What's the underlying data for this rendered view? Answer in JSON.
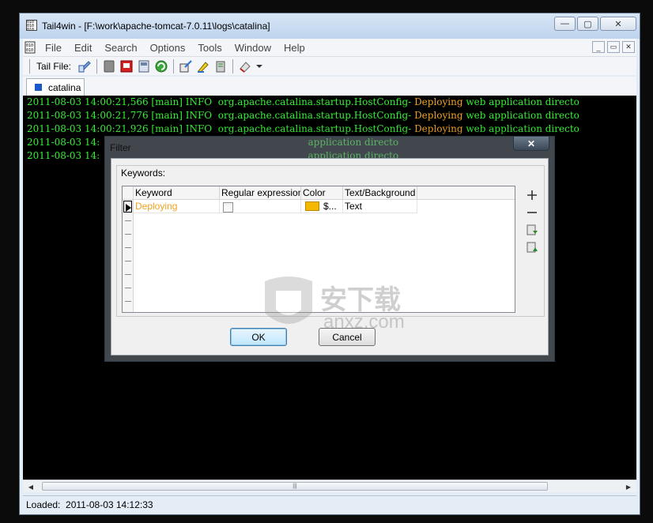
{
  "window": {
    "title": "Tail4win - [F:\\work\\apache-tomcat-7.0.11\\logs\\catalina]",
    "icon": "tail4win-app-icon",
    "controls": {
      "minimize": "▭",
      "maximize": "▢",
      "close": "✕"
    }
  },
  "menubar": {
    "items": [
      "File",
      "Edit",
      "Search",
      "Options",
      "Tools",
      "Window",
      "Help"
    ],
    "mdi_controls": {
      "minimize": "_",
      "restore": "▭",
      "close": "✕"
    }
  },
  "toolbar": {
    "tail_file_label": "Tail File:",
    "icons": [
      "open-file-icon",
      "stop-icon",
      "pdf-icon",
      "save-icon",
      "refresh-icon",
      "settings-icon",
      "highlight-icon",
      "filter-icon",
      "clear-icon"
    ]
  },
  "tabs": [
    {
      "label": "catalina",
      "icon": "file-tab-icon"
    }
  ],
  "log": {
    "lines": [
      {
        "prefix": "2011-08-03 14:00:21,566 [main] INFO  org.apache.catalina.startup.HostConfig- ",
        "highlight": "Deploying",
        "suffix": " web application directo"
      },
      {
        "prefix": "2011-08-03 14:00:21,776 [main] INFO  org.apache.catalina.startup.HostConfig- ",
        "highlight": "Deploying",
        "suffix": " web application directo"
      },
      {
        "prefix": "2011-08-03 14:00:21,926 [main] INFO  org.apache.catalina.startup.HostConfig- ",
        "highlight": "Deploying",
        "suffix": " web application directo"
      },
      {
        "prefix": "2011-08-03 14:",
        "highlight": "",
        "suffix": "                                                                     application directo"
      },
      {
        "prefix": "2011-08-03 14:",
        "highlight": "",
        "suffix": "                                                                     application directo"
      }
    ],
    "colors": {
      "text": "#34f034",
      "highlight": "#f0a321",
      "background": "#000000"
    }
  },
  "scrollbar": {
    "left_arrow": "◀",
    "right_arrow": "▶",
    "thumb_grip": "|||"
  },
  "status": {
    "text": "Loaded:  2011-08-03 14:12:33"
  },
  "dialog": {
    "title": "Filter",
    "close": "✕",
    "group_label": "Keywords:",
    "columns": [
      "Keyword",
      "Regular expression",
      "Color",
      "Text/Background"
    ],
    "rows": [
      {
        "keyword": "Deploying",
        "regex": false,
        "color_hex": "#f5b800",
        "color_text": "$...",
        "text_background": "Text"
      }
    ],
    "side_buttons": [
      "add-icon",
      "remove-icon",
      "import-icon",
      "export-icon"
    ],
    "ok_label": "OK",
    "cancel_label": "Cancel"
  },
  "watermark": {
    "text_cn": "安下载",
    "text_en": "anxz.com"
  }
}
